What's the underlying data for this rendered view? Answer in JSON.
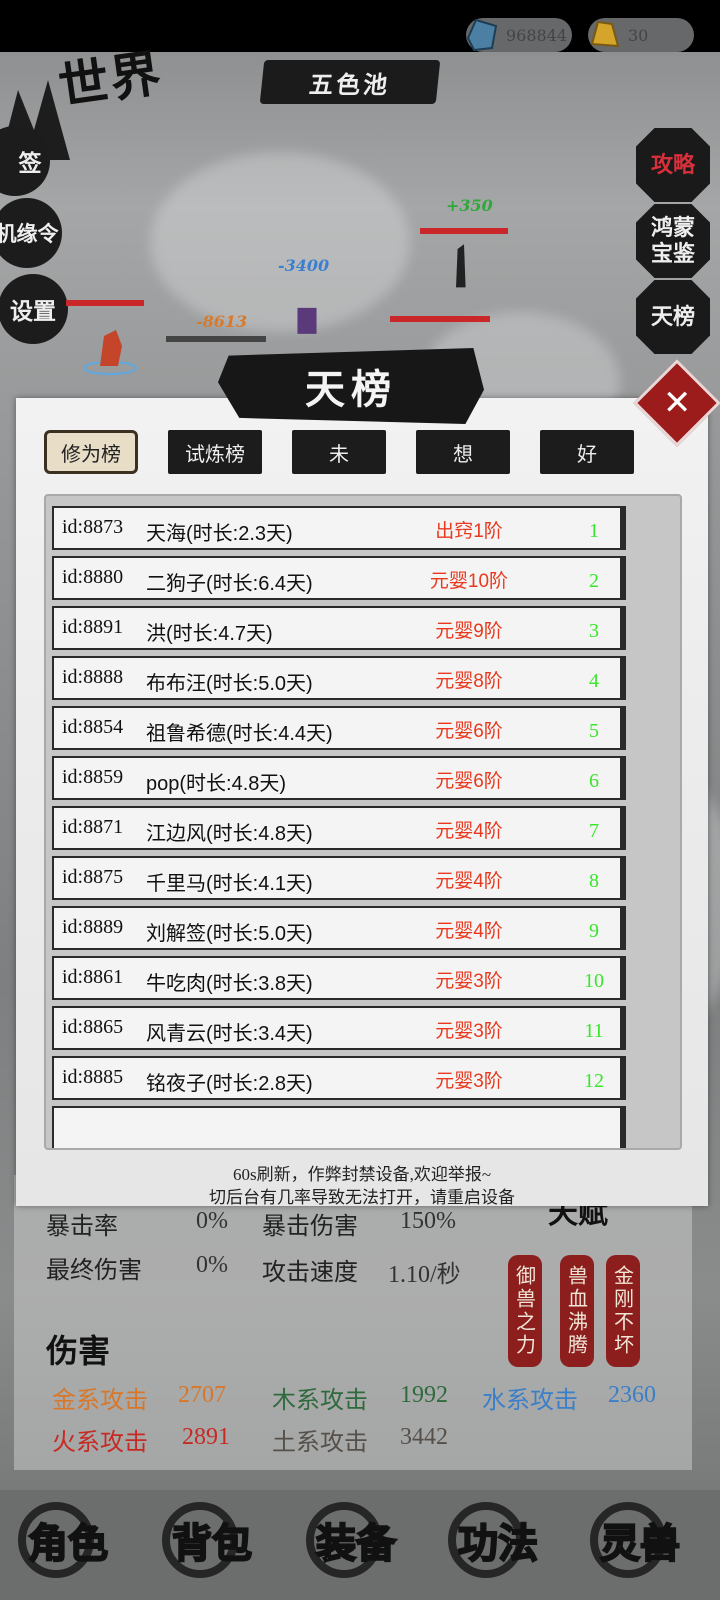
{
  "world": {
    "title": "世界"
  },
  "resources": {
    "spirit_stone": "968844",
    "gold": "30"
  },
  "pool": {
    "name": "五色池"
  },
  "left_menu": [
    {
      "label": "签"
    },
    {
      "label": "机缘令"
    },
    {
      "label": "设置"
    }
  ],
  "right_menu": [
    {
      "label": "攻略"
    },
    {
      "label": "鸿蒙宝鉴"
    },
    {
      "label": "天榜"
    }
  ],
  "battle": {
    "damage_1": "+350",
    "damage_2": "-3400",
    "damage_3": "-8613"
  },
  "modal": {
    "title": "天榜",
    "close_symbol": "✕",
    "tabs": [
      {
        "label": "修为榜",
        "active": true
      },
      {
        "label": "试炼榜",
        "active": false
      },
      {
        "label": "未",
        "active": false
      },
      {
        "label": "想",
        "active": false
      },
      {
        "label": "好",
        "active": false
      }
    ],
    "rows": [
      {
        "id": "id:8873",
        "name": "天海(时长:2.3天)",
        "rank": "出窍1阶",
        "pos": "1"
      },
      {
        "id": "id:8880",
        "name": "二狗子(时长:6.4天)",
        "rank": "元婴10阶",
        "pos": "2"
      },
      {
        "id": "id:8891",
        "name": "洪(时长:4.7天)",
        "rank": "元婴9阶",
        "pos": "3"
      },
      {
        "id": "id:8888",
        "name": "布布汪(时长:5.0天)",
        "rank": "元婴8阶",
        "pos": "4"
      },
      {
        "id": "id:8854",
        "name": "祖鲁希德(时长:4.4天)",
        "rank": "元婴6阶",
        "pos": "5"
      },
      {
        "id": "id:8859",
        "name": "pop(时长:4.8天)",
        "rank": "元婴6阶",
        "pos": "6"
      },
      {
        "id": "id:8871",
        "name": "江边风(时长:4.8天)",
        "rank": "元婴4阶",
        "pos": "7"
      },
      {
        "id": "id:8875",
        "name": "千里马(时长:4.1天)",
        "rank": "元婴4阶",
        "pos": "8"
      },
      {
        "id": "id:8889",
        "name": "刘解签(时长:5.0天)",
        "rank": "元婴4阶",
        "pos": "9"
      },
      {
        "id": "id:8861",
        "name": "牛吃肉(时长:3.8天)",
        "rank": "元婴3阶",
        "pos": "10"
      },
      {
        "id": "id:8865",
        "name": "风青云(时长:3.4天)",
        "rank": "元婴3阶",
        "pos": "11"
      },
      {
        "id": "id:8885",
        "name": "铭夜子(时长:2.8天)",
        "rank": "元婴3阶",
        "pos": "12"
      }
    ],
    "note_1": "60s刷新，作弊封禁设备,欢迎举报~",
    "note_2": "切后台有几率导致无法打开，请重启设备"
  },
  "stats": {
    "crit_rate_label": "暴击率",
    "crit_rate_value": "0%",
    "crit_dmg_label": "暴击伤害",
    "crit_dmg_value": "150%",
    "final_dmg_label": "最终伤害",
    "final_dmg_value": "0%",
    "atk_speed_label": "攻击速度",
    "atk_speed_value": "1.10/秒"
  },
  "talents": {
    "title": "天赋",
    "items": [
      "御兽之力",
      "兽血沸腾",
      "金刚不坏"
    ]
  },
  "damage": {
    "title": "伤害",
    "metal_label": "金系攻击",
    "metal_value": "2707",
    "metal_color": "#d8772a",
    "wood_label": "木系攻击",
    "wood_value": "1992",
    "wood_color": "#2f6a3c",
    "water_label": "水系攻击",
    "water_value": "2360",
    "water_color": "#3a7fc8",
    "fire_label": "火系攻击",
    "fire_value": "2891",
    "fire_color": "#c62a23",
    "earth_label": "土系攻击",
    "earth_value": "3442",
    "earth_color": "#55504a"
  },
  "nav": [
    {
      "label": "角色"
    },
    {
      "label": "背包"
    },
    {
      "label": "装备"
    },
    {
      "label": "功法"
    },
    {
      "label": "灵兽"
    }
  ]
}
